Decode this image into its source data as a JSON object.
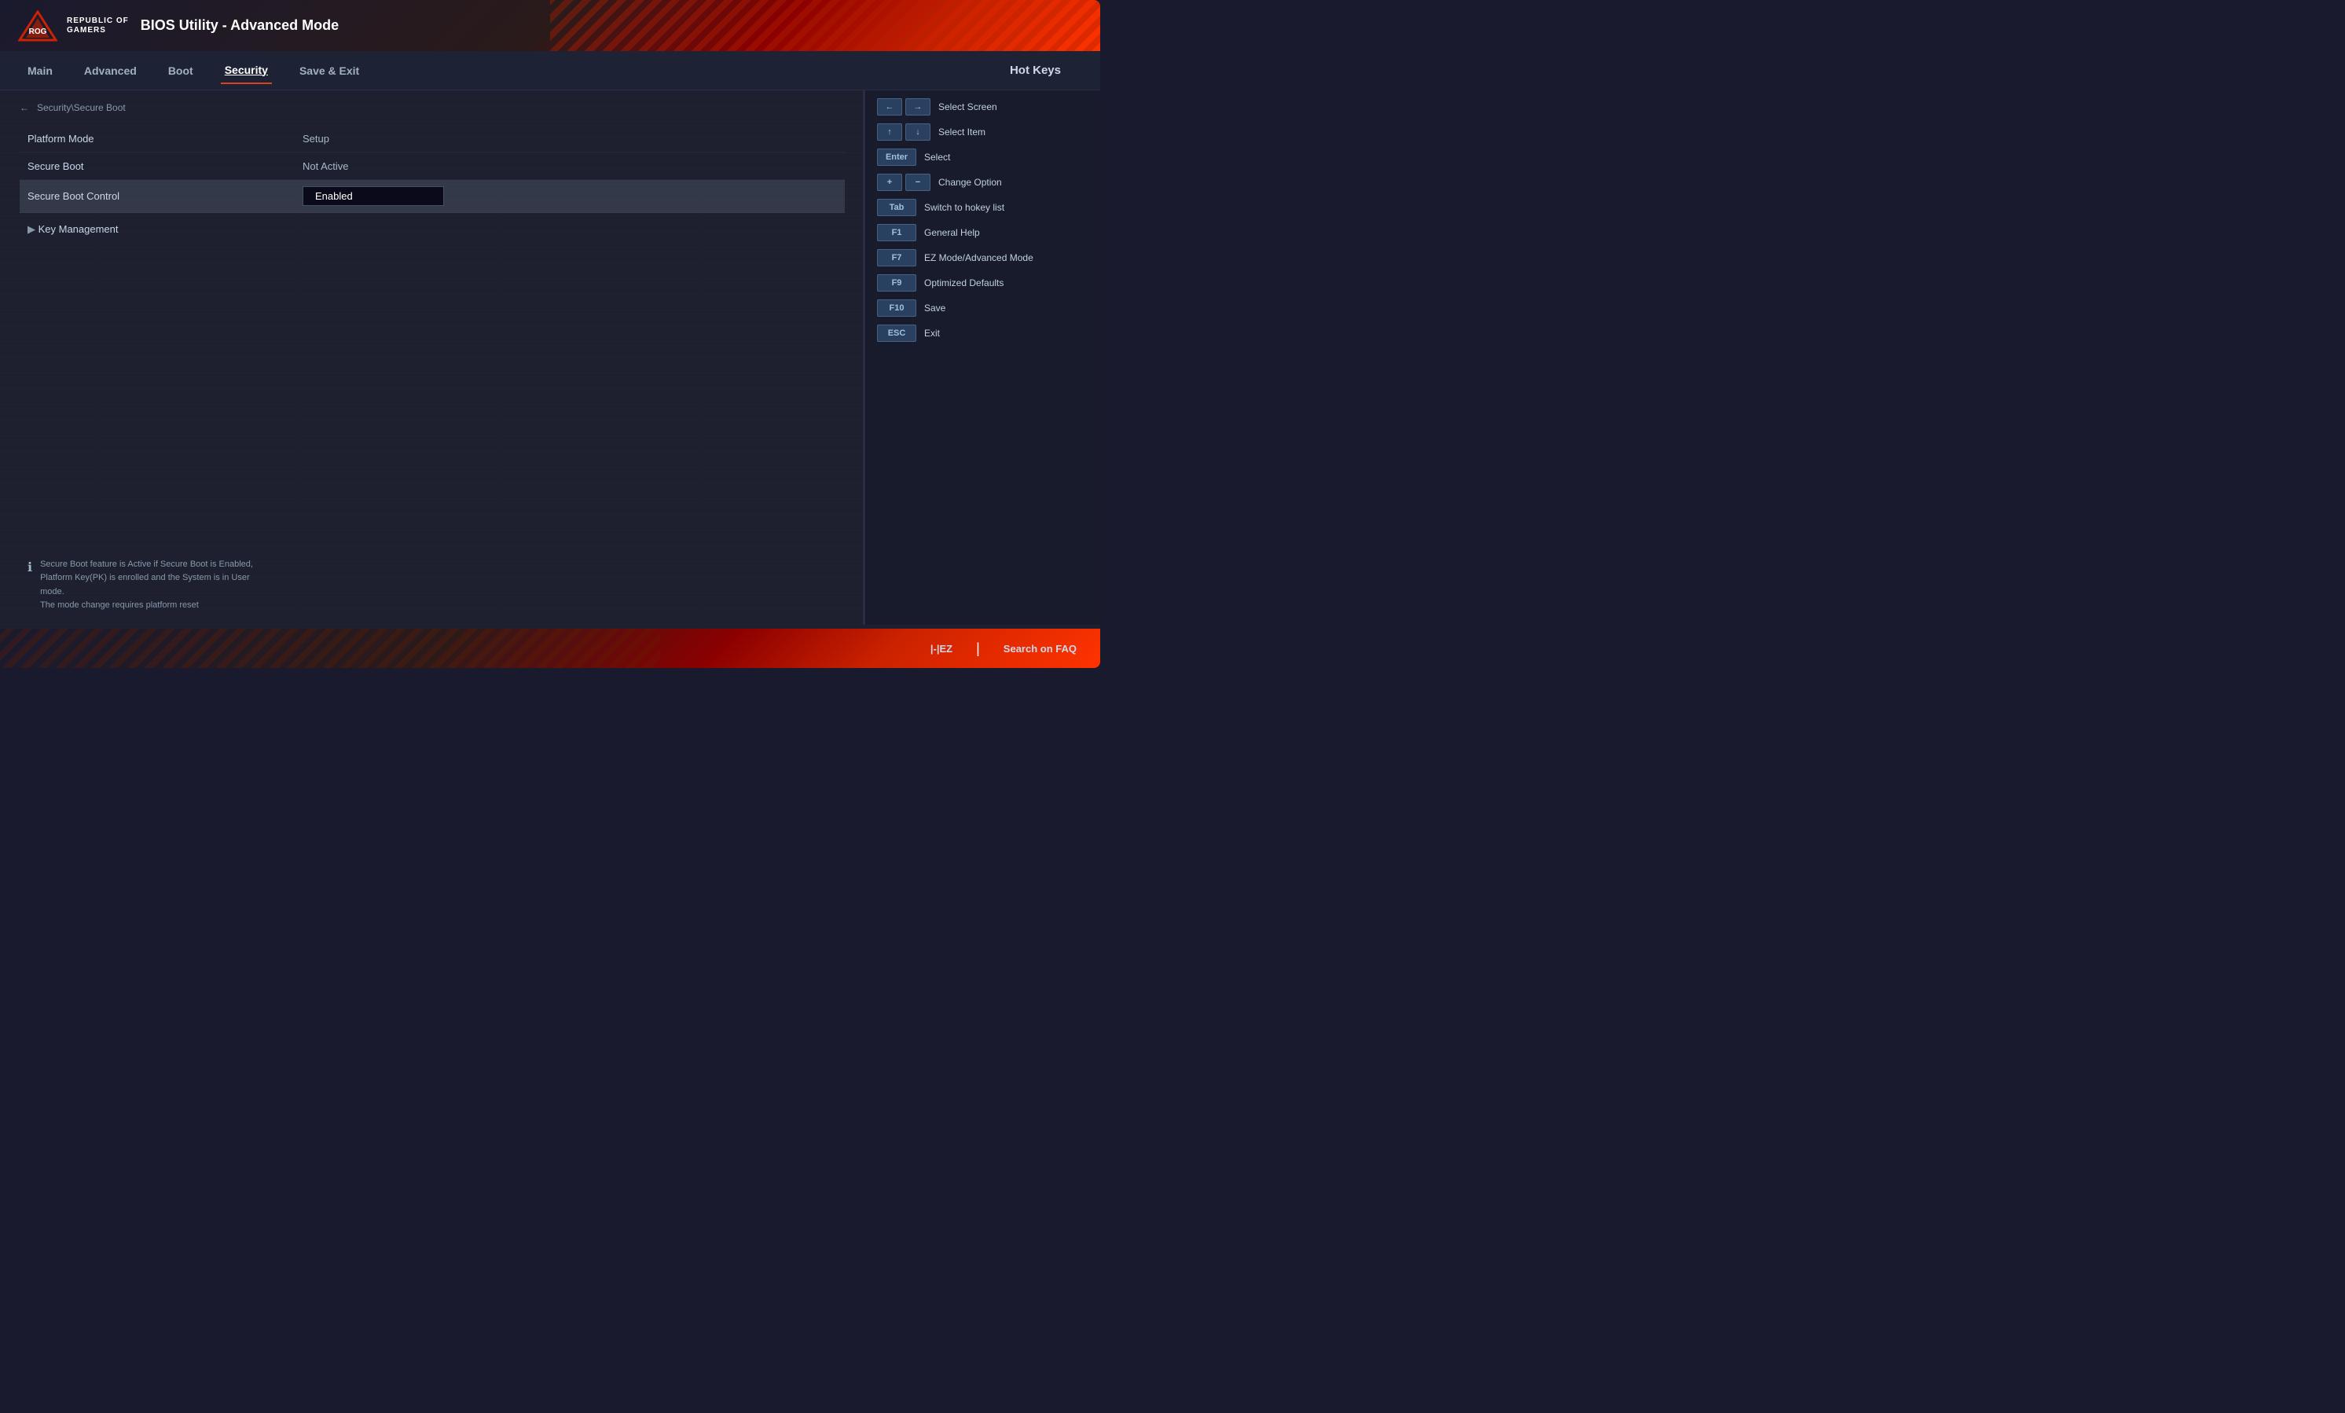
{
  "header": {
    "logo_line1": "REPUBLIC OF",
    "logo_line2": "GAMERS",
    "title": "BIOS Utility - Advanced Mode"
  },
  "nav": {
    "items": [
      {
        "id": "main",
        "label": "Main",
        "active": false
      },
      {
        "id": "advanced",
        "label": "Advanced",
        "active": false
      },
      {
        "id": "boot",
        "label": "Boot",
        "active": false
      },
      {
        "id": "security",
        "label": "Security",
        "active": true
      },
      {
        "id": "save-exit",
        "label": "Save & Exit",
        "active": false
      }
    ],
    "hotkeys_label": "Hot Keys"
  },
  "breadcrumb": {
    "text": "Security\\Secure Boot"
  },
  "settings": [
    {
      "label": "Platform Mode",
      "value": "Setup",
      "type": "text"
    },
    {
      "label": "Secure Boot",
      "value": "Not Active",
      "type": "text"
    },
    {
      "label": "Secure Boot Control",
      "value": "Enabled",
      "type": "box",
      "highlighted": true
    }
  ],
  "key_management": {
    "label": "Key Management"
  },
  "info": {
    "text": "Secure Boot feature is Active if Secure Boot is Enabled,\nPlatform Key(PK) is enrolled and the System is in User mode.\nThe mode change requires platform reset"
  },
  "hotkeys": [
    {
      "buttons": [
        "←",
        "→"
      ],
      "description": "Select Screen"
    },
    {
      "buttons": [
        "↑",
        "↓"
      ],
      "description": "Select Item"
    },
    {
      "buttons": [
        "Enter"
      ],
      "description": "Select"
    },
    {
      "buttons": [
        "+",
        "−"
      ],
      "description": "Change Option"
    },
    {
      "buttons": [
        "Tab"
      ],
      "description": "Switch to hokey list"
    },
    {
      "buttons": [
        "F1"
      ],
      "description": "General Help"
    },
    {
      "buttons": [
        "F7"
      ],
      "description": "EZ Mode/Advanced Mode"
    },
    {
      "buttons": [
        "F9"
      ],
      "description": "Optimized Defaults"
    },
    {
      "buttons": [
        "F10"
      ],
      "description": "Save"
    },
    {
      "buttons": [
        "ESC"
      ],
      "description": "Exit"
    }
  ],
  "bottom_bar": {
    "ez_mode_label": "|-|EZ",
    "divider": "|",
    "search_label": "Search on FAQ"
  }
}
